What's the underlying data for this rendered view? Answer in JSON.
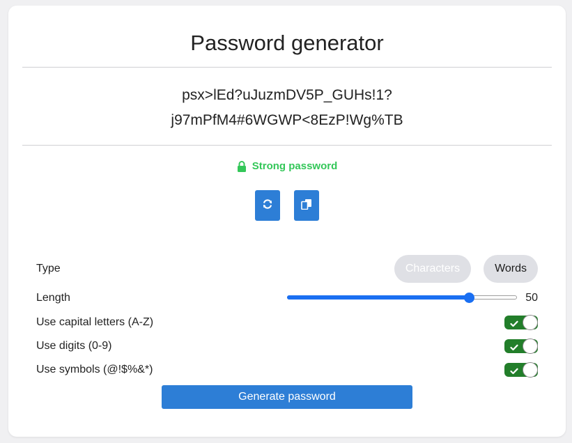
{
  "title": "Password generator",
  "password": {
    "line1": "psx>lEd?uJuzmDV5P_GUHs!1?",
    "line2": "j97mPfM4#6WGWP<8EzP!Wg%TB"
  },
  "strength": {
    "label": "Strong password",
    "icon": "lock-icon",
    "color": "#34c759"
  },
  "actions": {
    "regenerate_icon": "refresh-icon",
    "copy_icon": "copy-icon"
  },
  "options": {
    "type": {
      "label": "Type",
      "choices": [
        "Characters",
        "Words"
      ],
      "selected": "Words"
    },
    "length": {
      "label": "Length",
      "value": "50",
      "fraction": 0.79
    },
    "capitals": {
      "label": "Use capital letters (A-Z)",
      "enabled": true
    },
    "digits": {
      "label": "Use digits (0-9)",
      "enabled": true
    },
    "symbols": {
      "label": "Use symbols (@!$%&*)",
      "enabled": true
    }
  },
  "generate_label": "Generate password",
  "colors": {
    "accent": "#2d7ed6",
    "toggle_on": "#227e2a",
    "slider": "#1a6ff2"
  }
}
